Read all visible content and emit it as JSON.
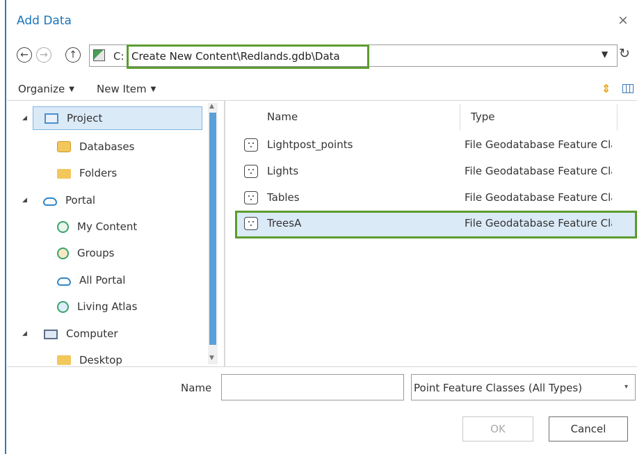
{
  "window": {
    "title": "Add Data",
    "close_glyph": "×"
  },
  "nav": {
    "back_glyph": "←",
    "forward_glyph": "→",
    "up_glyph": "↑",
    "address_prefix": "C:",
    "address_path": "Create New Content\\Redlands.gdb\\Data",
    "dropdown_glyph": "▼",
    "refresh_glyph": "↻"
  },
  "toolbar": {
    "organize_label": "Organize",
    "new_item_label": "New Item",
    "caret": "▼",
    "sort_glyph": "⇕"
  },
  "tree": {
    "expand_glyph": "◢",
    "items": [
      {
        "label": "Project"
      },
      {
        "label": "Databases"
      },
      {
        "label": "Folders"
      },
      {
        "label": "Portal"
      },
      {
        "label": "My Content"
      },
      {
        "label": "Groups"
      },
      {
        "label": "All Portal"
      },
      {
        "label": "Living Atlas"
      },
      {
        "label": "Computer"
      },
      {
        "label": "Desktop"
      }
    ]
  },
  "list": {
    "columns": [
      "Name",
      "Type"
    ],
    "rows": [
      {
        "name": "Lightpost_points",
        "type": "File Geodatabase Feature Class"
      },
      {
        "name": "Lights",
        "type": "File Geodatabase Feature Class"
      },
      {
        "name": "Tables",
        "type": "File Geodatabase Feature Class"
      },
      {
        "name": "TreesA",
        "type": "File Geodatabase Feature Class"
      }
    ],
    "selected_row": "TreesA"
  },
  "footer": {
    "name_label": "Name",
    "name_value": "",
    "filter_value": "Point Feature Classes (All Types)",
    "filter_dd_glyph": "▾",
    "ok_label": "OK",
    "cancel_label": "Cancel"
  },
  "colors": {
    "accent": "#1b75bb",
    "highlight_border": "#5b9c2f",
    "selection_bg": "#dbeaf7"
  }
}
